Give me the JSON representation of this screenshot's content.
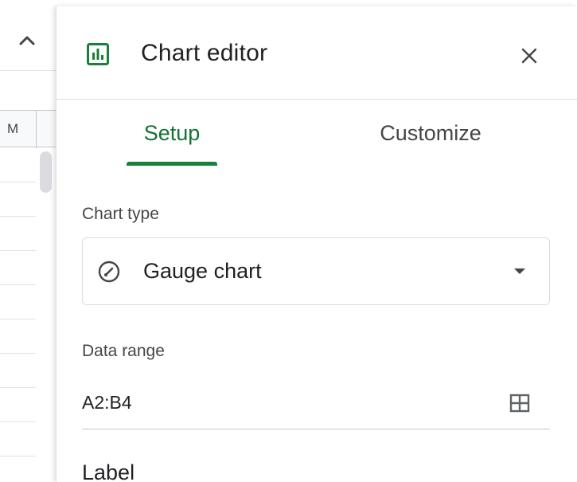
{
  "sheet": {
    "column_label": "M"
  },
  "panel": {
    "title": "Chart editor"
  },
  "tabs": [
    {
      "label": "Setup",
      "active": true
    },
    {
      "label": "Customize",
      "active": false
    }
  ],
  "setup": {
    "chart_type_label": "Chart type",
    "chart_type_value": "Gauge chart",
    "data_range_label": "Data range",
    "data_range_value": "A2:B4",
    "next_section_heading": "Label"
  },
  "colors": {
    "accent_green": "#188038",
    "tab_active_text": "#137333",
    "text_primary": "#202124",
    "text_secondary": "#444746",
    "border": "#dadce0"
  },
  "icons": {
    "collapse": "chevron-up-icon",
    "chart": "bar-chart-icon",
    "close": "close-icon",
    "chart_type": "gauge-icon",
    "dropdown": "arrow-drop-down-icon",
    "range_select": "grid-icon"
  }
}
